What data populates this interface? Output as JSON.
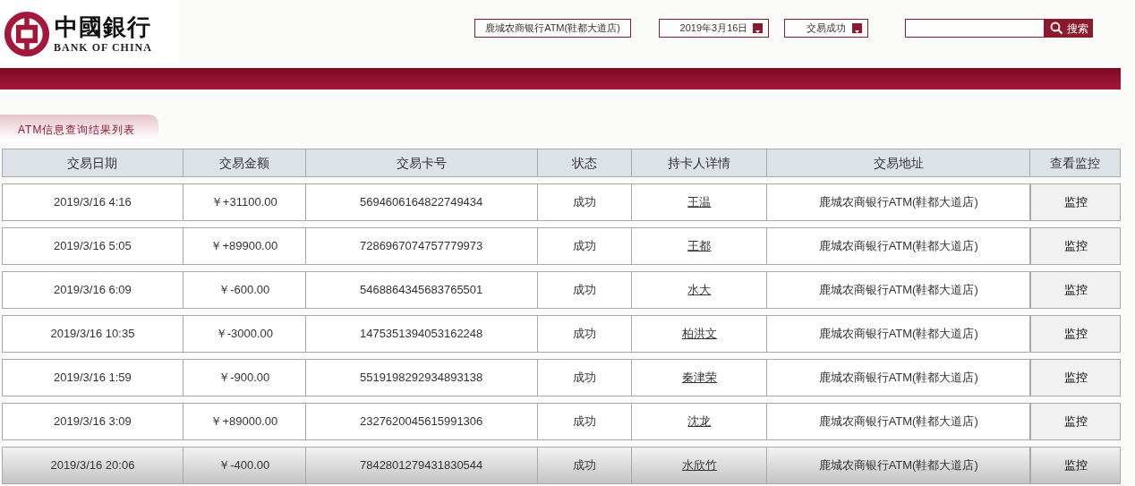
{
  "logo": {
    "chinese": "中國銀行",
    "english": "BANK OF CHINA"
  },
  "filters": {
    "location": "鹿城农商银行ATM(鞋都大道店)",
    "date": "2019年3月16日",
    "status": "交易成功",
    "search_button": "搜索"
  },
  "section_tab": "ATM信息查询结果列表",
  "table": {
    "columns": [
      "交易日期",
      "交易金额",
      "交易卡号",
      "状态",
      "持卡人详情",
      "交易地址",
      "查看监控"
    ],
    "rows": [
      {
        "date": "2019/3/16 4:16",
        "amount": "￥+31100.00",
        "card": "5694606164822749434",
        "status": "成功",
        "holder": "王温",
        "address": "鹿城农商银行ATM(鞋都大道店)",
        "action": "监控",
        "selected": false
      },
      {
        "date": "2019/3/16 5:05",
        "amount": "￥+89900.00",
        "card": "7286967074757779973",
        "status": "成功",
        "holder": "王都",
        "address": "鹿城农商银行ATM(鞋都大道店)",
        "action": "监控",
        "selected": false
      },
      {
        "date": "2019/3/16 6:09",
        "amount": "￥-600.00",
        "card": "5468864345683765501",
        "status": "成功",
        "holder": "水大",
        "address": "鹿城农商银行ATM(鞋都大道店)",
        "action": "监控",
        "selected": false
      },
      {
        "date": "2019/3/16 10:35",
        "amount": "￥-3000.00",
        "card": "1475351394053162248",
        "status": "成功",
        "holder": "柏洪文",
        "address": "鹿城农商银行ATM(鞋都大道店)",
        "action": "监控",
        "selected": false
      },
      {
        "date": "2019/3/16 1:59",
        "amount": "￥-900.00",
        "card": "5519198292934893138",
        "status": "成功",
        "holder": "秦津荣",
        "address": "鹿城农商银行ATM(鞋都大道店)",
        "action": "监控",
        "selected": false
      },
      {
        "date": "2019/3/16 3:09",
        "amount": "￥+89000.00",
        "card": "2327620045615991306",
        "status": "成功",
        "holder": "沈龙",
        "address": "鹿城农商银行ATM(鞋都大道店)",
        "action": "监控",
        "selected": false
      },
      {
        "date": "2019/3/16 20:06",
        "amount": "￥-400.00",
        "card": "7842801279431830544",
        "status": "成功",
        "holder": "水欣竹",
        "address": "鹿城农商银行ATM(鞋都大道店)",
        "action": "监控",
        "selected": true
      }
    ]
  }
}
